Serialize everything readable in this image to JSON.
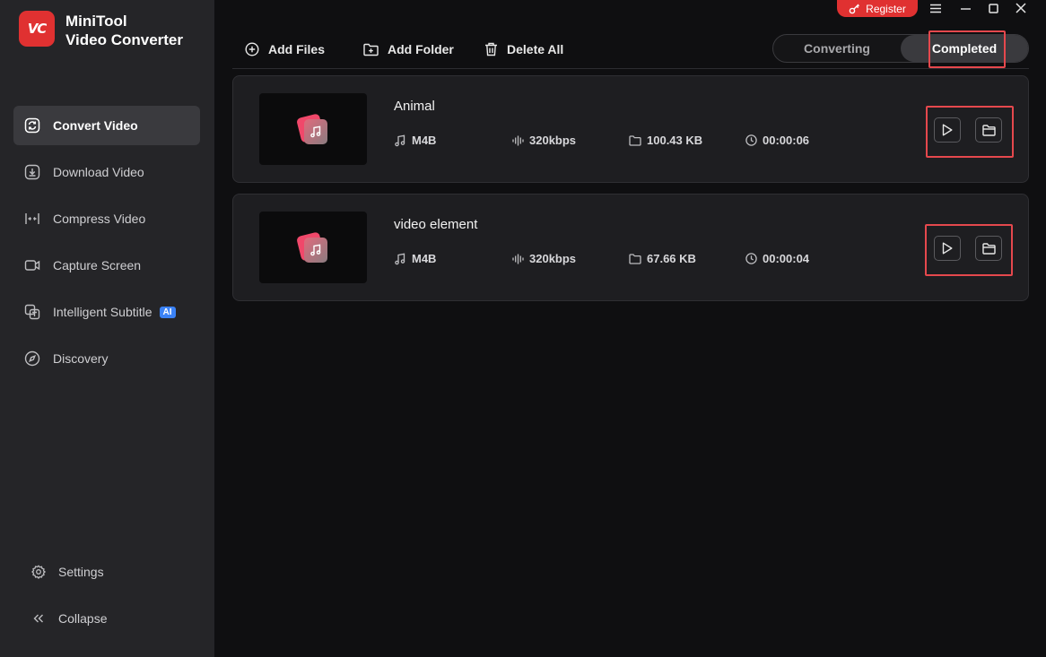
{
  "app": {
    "logo_text": "VC",
    "title_line1": "MiniTool",
    "title_line2": "Video Converter"
  },
  "sidebar": {
    "items": [
      {
        "label": "Convert Video",
        "icon": "convert-icon",
        "active": true
      },
      {
        "label": "Download Video",
        "icon": "download-icon",
        "active": false
      },
      {
        "label": "Compress Video",
        "icon": "compress-icon",
        "active": false
      },
      {
        "label": "Capture Screen",
        "icon": "camera-icon",
        "active": false
      },
      {
        "label": "Intelligent Subtitle",
        "icon": "subtitle-icon",
        "active": false,
        "badge": "AI"
      },
      {
        "label": "Discovery",
        "icon": "compass-icon",
        "active": false
      }
    ],
    "settings_label": "Settings",
    "collapse_label": "Collapse"
  },
  "titlebar": {
    "register_label": "Register"
  },
  "toolbar": {
    "add_files": "Add Files",
    "add_folder": "Add Folder",
    "delete_all": "Delete All"
  },
  "tabs": {
    "converting": "Converting",
    "completed": "Completed",
    "selected": "Completed"
  },
  "files": [
    {
      "name": "Animal",
      "format": "M4B",
      "bitrate": "320kbps",
      "size": "100.43 KB",
      "duration": "00:00:06"
    },
    {
      "name": "video element",
      "format": "M4B",
      "bitrate": "320kbps",
      "size": "67.66 KB",
      "duration": "00:00:04"
    }
  ],
  "colors": {
    "accent": "#e03131",
    "highlight_box": "#e5484d",
    "ai_badge": "#3b82f6",
    "background": "#0f0f11",
    "sidebar": "#252528"
  }
}
